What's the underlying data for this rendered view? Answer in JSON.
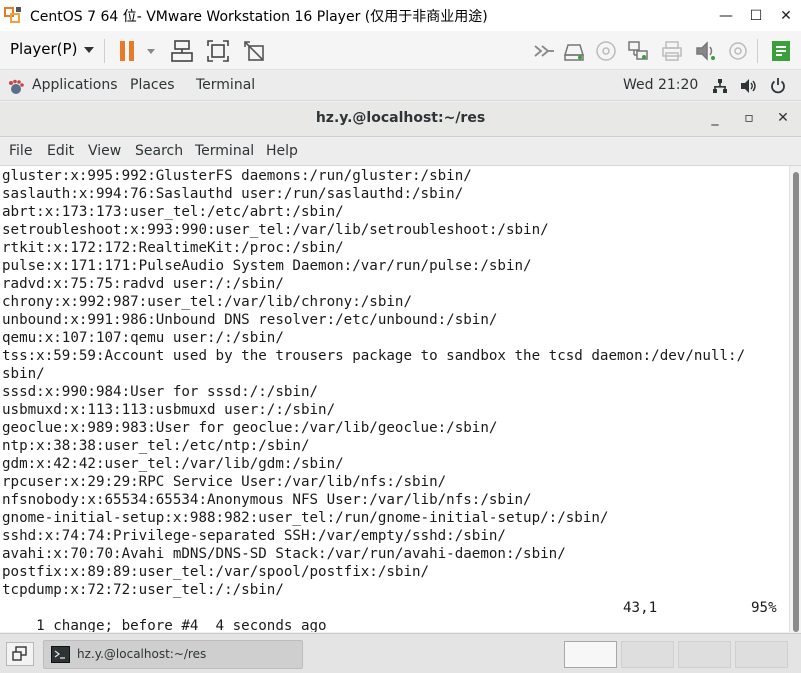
{
  "vm_window": {
    "title": "CentOS 7 64 位- VMware Workstation 16 Player (仅用于非商业用途)",
    "minimize": "—",
    "maximize": "☐",
    "close": "✕"
  },
  "vm_toolbar": {
    "player_menu": "Player(P)",
    "icons": [
      "pause-icon",
      "send-ctrl-alt-del-icon",
      "fullscreen-icon",
      "unity-icon",
      "forward-icon",
      "hard-disk-icon",
      "cd-icon",
      "network-icon",
      "printer-icon",
      "sound-icon",
      "usb-icon",
      "notes-icon"
    ],
    "accent_color": "#e8792b"
  },
  "gnome_bar": {
    "applications": "Applications",
    "places": "Places",
    "terminal": "Terminal",
    "clock": "Wed 21:20"
  },
  "terminal_window": {
    "title": "hz.y.@localhost:~/res",
    "minimize": "_",
    "maximize": "▫",
    "close": "✕"
  },
  "terminal_menu": {
    "file": "File",
    "edit": "Edit",
    "view": "View",
    "search": "Search",
    "terminal": "Terminal",
    "help": "Help"
  },
  "terminal_lines": [
    "gluster:x:995:992:GlusterFS daemons:/run/gluster:/sbin/",
    "saslauth:x:994:76:Saslauthd user:/run/saslauthd:/sbin/",
    "abrt:x:173:173:user_tel:/etc/abrt:/sbin/",
    "setroubleshoot:x:993:990:user_tel:/var/lib/setroubleshoot:/sbin/",
    "rtkit:x:172:172:RealtimeKit:/proc:/sbin/",
    "pulse:x:171:171:PulseAudio System Daemon:/var/run/pulse:/sbin/",
    "radvd:x:75:75:radvd user:/:/sbin/",
    "chrony:x:992:987:user_tel:/var/lib/chrony:/sbin/",
    "unbound:x:991:986:Unbound DNS resolver:/etc/unbound:/sbin/",
    "qemu:x:107:107:qemu user:/:/sbin/",
    "tss:x:59:59:Account used by the trousers package to sandbox the tcsd daemon:/dev/null:/",
    "sbin/",
    "sssd:x:990:984:User for sssd:/:/sbin/",
    "usbmuxd:x:113:113:usbmuxd user:/:/sbin/",
    "geoclue:x:989:983:User for geoclue:/var/lib/geoclue:/sbin/",
    "ntp:x:38:38:user_tel:/etc/ntp:/sbin/",
    "gdm:x:42:42:user_tel:/var/lib/gdm:/sbin/",
    "rpcuser:x:29:29:RPC Service User:/var/lib/nfs:/sbin/",
    "nfsnobody:x:65534:65534:Anonymous NFS User:/var/lib/nfs:/sbin/",
    "gnome-initial-setup:x:988:982:user_tel:/run/gnome-initial-setup/:/sbin/",
    "sshd:x:74:74:Privilege-separated SSH:/var/empty/sshd:/sbin/",
    "avahi:x:70:70:Avahi mDNS/DNS-SD Stack:/var/run/avahi-daemon:/sbin/",
    "postfix:x:89:89:user_tel:/var/spool/postfix:/sbin/",
    "tcpdump:x:72:72:user_tel:/:/sbin/"
  ],
  "status_line": {
    "message": "1 change; before #4  4 seconds ago",
    "position": "43,1",
    "percent": "95%"
  },
  "taskbar": {
    "window_label": "hz.y.@localhost:~/res"
  }
}
